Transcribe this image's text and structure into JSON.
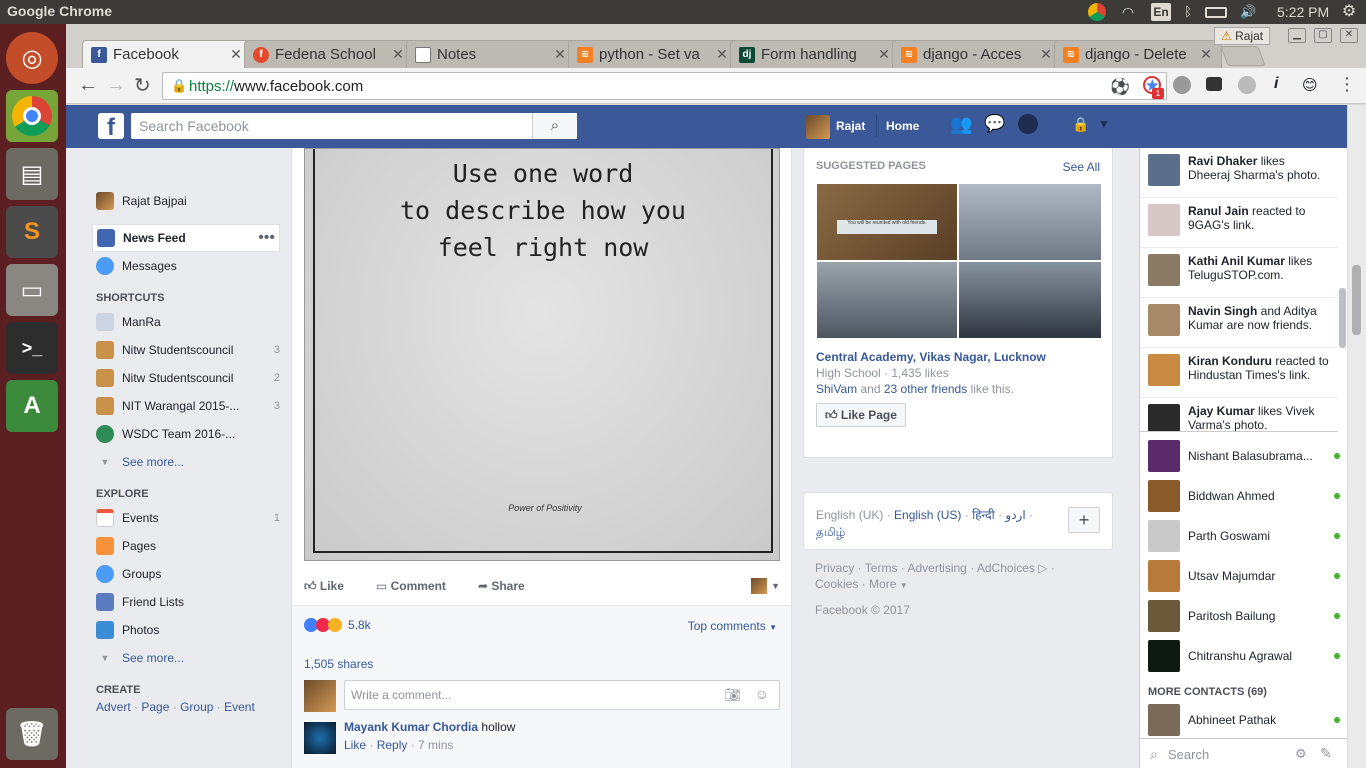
{
  "system": {
    "app_name": "Google Chrome",
    "clock": "5:22 PM",
    "keyboard": "En"
  },
  "tabs": [
    {
      "label": "Facebook",
      "icon": "facebook-icon",
      "color": "#3b5998",
      "glyph": "f"
    },
    {
      "label": "Fedena School",
      "icon": "fedena-icon",
      "color": "#e04b2c",
      "glyph": "f"
    },
    {
      "label": "Notes",
      "icon": "document-icon",
      "color": "#ffffff",
      "glyph": ""
    },
    {
      "label": "python - Set va",
      "icon": "stackoverflow-icon",
      "color": "#f48024",
      "glyph": "≋"
    },
    {
      "label": "Form handling",
      "icon": "django-icon",
      "color": "#0c4b33",
      "glyph": "dj"
    },
    {
      "label": "django - Acces",
      "icon": "stackoverflow-icon",
      "color": "#f48024",
      "glyph": "≋"
    },
    {
      "label": "django - Delete",
      "icon": "stackoverflow-icon",
      "color": "#f48024",
      "glyph": "≋"
    }
  ],
  "profile_chip": "Rajat",
  "url": {
    "scheme": "https://",
    "host": "www.facebook.com"
  },
  "extension_badge": "1",
  "fb": {
    "search_placeholder": "Search Facebook",
    "user_name": "Rajat",
    "home": "Home",
    "left": {
      "profile_name": "Rajat Bajpai",
      "news_feed": "News Feed",
      "messages": "Messages",
      "shortcuts_header": "SHORTCUTS",
      "shortcuts": [
        {
          "label": "ManRa",
          "count": ""
        },
        {
          "label": "Nitw Studentscouncil",
          "count": "3"
        },
        {
          "label": "Nitw Studentscouncil",
          "count": "2"
        },
        {
          "label": "NIT Warangal 2015-...",
          "count": "3"
        },
        {
          "label": "WSDC Team 2016-...",
          "count": ""
        }
      ],
      "see_more": "See more...",
      "explore_header": "EXPLORE",
      "explore": [
        {
          "label": "Events",
          "count": "1"
        },
        {
          "label": "Pages",
          "count": ""
        },
        {
          "label": "Groups",
          "count": ""
        },
        {
          "label": "Friend Lists",
          "count": ""
        },
        {
          "label": "Photos",
          "count": ""
        }
      ],
      "create_header": "CREATE",
      "create_links": [
        "Advert",
        "Page",
        "Group",
        "Event"
      ]
    },
    "post": {
      "quote_line1": "Use one word",
      "quote_line2": "to describe how you",
      "quote_line3": "feel right now",
      "watermark": "Power of Positivity",
      "like": "Like",
      "comment": "Comment",
      "share": "Share",
      "reactions": "5.8k",
      "top_comments": "Top comments",
      "shares": "1,505 shares",
      "comment_placeholder": "Write a comment...",
      "commenter": "Mayank Kumar Chordia",
      "comment_text": "hollow",
      "comment_like": "Like",
      "comment_reply": "Reply",
      "comment_time": "7 mins"
    },
    "suggested": {
      "header": "SUGGESTED PAGES",
      "see_all": "See All",
      "note_text": "You will be reunited with old friends.",
      "page_name": "Central Academy, Vikas Nagar, Lucknow",
      "page_meta": "High School · 1,435 likes",
      "friend": "ShiVam",
      "and": " and ",
      "others": "23 other friends",
      "like_this": " like this.",
      "like_page": "Like Page"
    },
    "languages": {
      "uk": "English (UK)",
      "us": "English (US)",
      "hindi": "हिन्दी",
      "urdu": "اردو",
      "tamil": "தமிழ்"
    },
    "footer": {
      "privacy": "Privacy",
      "terms": "Terms",
      "advertising": "Advertising",
      "adchoices": "AdChoices",
      "cookies": "Cookies",
      "more": "More",
      "copyright": "Facebook © 2017"
    },
    "ticker": [
      {
        "name": "Ravi Dhaker",
        "rest": " likes Dheeraj Sharma's photo."
      },
      {
        "name": "Ranul Jain",
        "rest": " reacted to 9GAG's link."
      },
      {
        "name": "Kathi Anil Kumar",
        "rest": " likes TeluguSTOP.com."
      },
      {
        "name": "Navin Singh",
        "rest": " and Aditya Kumar are now friends."
      },
      {
        "name": "Kiran Konduru",
        "rest": " reacted to Hindustan Times's link."
      },
      {
        "name": "Ajay Kumar",
        "rest": " likes Vivek Varma's photo."
      }
    ],
    "contacts": [
      "Nishant Balasubrama...",
      "Biddwan Ahmed",
      "Parth Goswami",
      "Utsav Majumdar",
      "Paritosh Bailung",
      "Chitranshu Agrawal"
    ],
    "more_contacts": "MORE CONTACTS (69)",
    "extra_contact": "Abhineet Pathak",
    "chat_search": "Search"
  }
}
